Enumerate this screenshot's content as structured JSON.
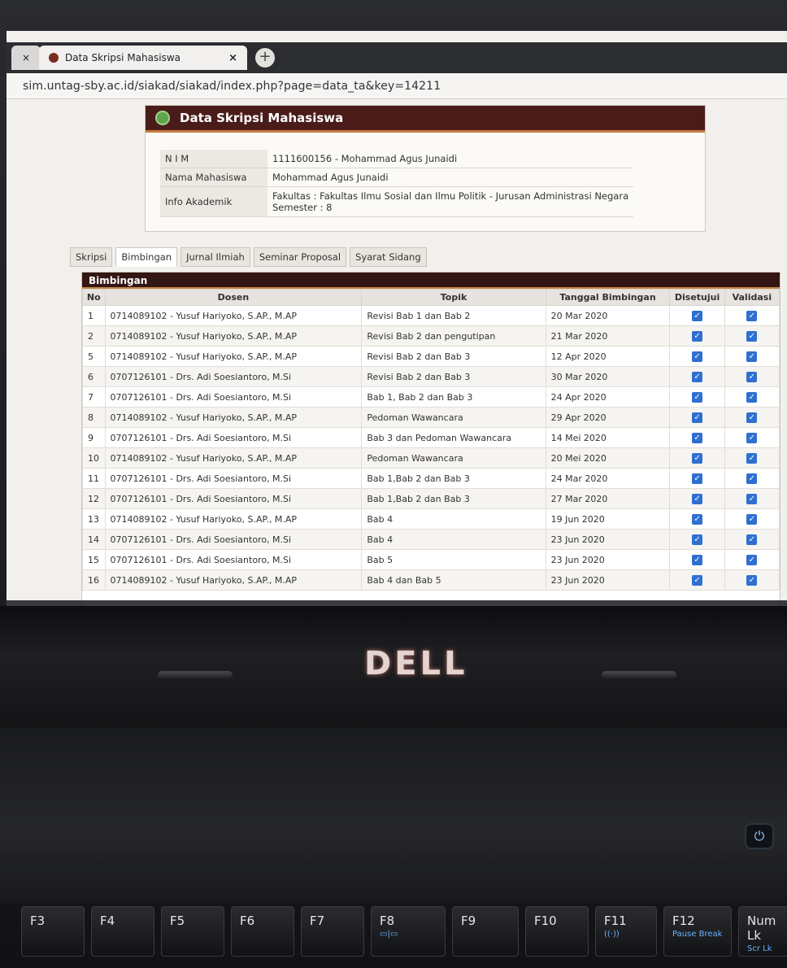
{
  "browser": {
    "active_tab_title": "Data Skripsi Mahasiswa",
    "tab_close": "×",
    "new_tab": "+",
    "url": "sim.untag-sby.ac.id/siakad/siakad/index.php?page=data_ta&key=14211"
  },
  "info": {
    "header": "Data Skripsi Mahasiswa",
    "nim_label": "N I M",
    "nim_value": "1111600156 - Mohammad Agus Junaidi",
    "nama_label": "Nama Mahasiswa",
    "nama_value": "Mohammad Agus Junaidi",
    "akademik_label": "Info Akademik",
    "fakultas_line": "Fakultas   : Fakultas Ilmu Sosial dan Ilmu Politik - Jurusan Administrasi Negara",
    "semester_line": "Semester : 8"
  },
  "tabs": [
    "Skripsi",
    "Bimbingan",
    "Jurnal Ilmiah",
    "Seminar Proposal",
    "Syarat Sidang"
  ],
  "bimbingan": {
    "title": "Bimbingan",
    "headers": [
      "No",
      "Dosen",
      "Topik",
      "Tanggal Bimbingan",
      "Disetujui",
      "Validasi"
    ],
    "rows": [
      [
        "1",
        "0714089102 - Yusuf Hariyoko, S.AP., M.AP",
        "Revisi Bab 1 dan Bab 2",
        "20 Mar 2020"
      ],
      [
        "2",
        "0714089102 - Yusuf Hariyoko, S.AP., M.AP",
        "Revisi Bab 2 dan pengutipan",
        "21 Mar 2020"
      ],
      [
        "5",
        "0714089102 - Yusuf Hariyoko, S.AP., M.AP",
        "Revisi Bab 2 dan Bab 3",
        "12 Apr 2020"
      ],
      [
        "6",
        "0707126101 - Drs. Adi Soesiantoro, M.Si",
        "Revisi Bab 2 dan Bab 3",
        "30 Mar 2020"
      ],
      [
        "7",
        "0707126101 - Drs. Adi Soesiantoro, M.Si",
        "Bab 1, Bab 2 dan Bab 3",
        "24 Apr 2020"
      ],
      [
        "8",
        "0714089102 - Yusuf Hariyoko, S.AP., M.AP",
        "Pedoman Wawancara",
        "29 Apr 2020"
      ],
      [
        "9",
        "0707126101 - Drs. Adi Soesiantoro, M.Si",
        "Bab 3 dan Pedoman Wawancara",
        "14 Mei 2020"
      ],
      [
        "10",
        "0714089102 - Yusuf Hariyoko, S.AP., M.AP",
        "Pedoman Wawancara",
        "20 Mei 2020"
      ],
      [
        "11",
        "0707126101 - Drs. Adi Soesiantoro, M.Si",
        "Bab 1,Bab 2 dan Bab 3",
        "24 Mar 2020"
      ],
      [
        "12",
        "0707126101 - Drs. Adi Soesiantoro, M.Si",
        "Bab 1,Bab 2 dan Bab 3",
        "27 Mar 2020"
      ],
      [
        "13",
        "0714089102 - Yusuf Hariyoko, S.AP., M.AP",
        "Bab 4",
        "19 Jun 2020"
      ],
      [
        "14",
        "0707126101 - Drs. Adi Soesiantoro, M.Si",
        "Bab 4",
        "23 Jun 2020"
      ],
      [
        "15",
        "0707126101 - Drs. Adi Soesiantoro, M.Si",
        "Bab 5",
        "23 Jun 2020"
      ],
      [
        "16",
        "0714089102 - Yusuf Hariyoko, S.AP., M.AP",
        "Bab 4 dan Bab 5",
        "23 Jun 2020"
      ]
    ]
  },
  "laptop": {
    "brand": "DELL",
    "keys": [
      {
        "label": "F3",
        "sub": ""
      },
      {
        "label": "F4",
        "sub": ""
      },
      {
        "label": "F5",
        "sub": ""
      },
      {
        "label": "F6",
        "sub": ""
      },
      {
        "label": "F7",
        "sub": ""
      },
      {
        "label": "F8",
        "sub": "▭|▭"
      },
      {
        "label": "F9",
        "sub": ""
      },
      {
        "label": "F10",
        "sub": ""
      },
      {
        "label": "F11",
        "sub": "((·))"
      },
      {
        "label": "F12",
        "sub": "Pause Break"
      },
      {
        "label": "Num Lk",
        "sub": "Scr Lk"
      }
    ]
  },
  "colors": {
    "header_bg": "#4a1c19",
    "accent_stripe": "#c87a3c",
    "checkbox": "#2f6fd0"
  }
}
